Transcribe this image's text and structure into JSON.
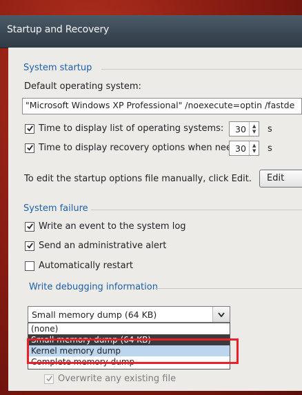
{
  "window": {
    "title": "Startup and Recovery"
  },
  "system_startup": {
    "group_label": "System startup",
    "default_os_label": "Default operating system:",
    "default_os_value": "\"Microsoft Windows XP Professional\" /noexecute=optin /fastde",
    "time_list_label": "Time to display list of operating systems:",
    "time_list_checked": true,
    "time_list_value": "30",
    "time_recovery_label": "Time to display recovery options when needed:",
    "time_recovery_checked": true,
    "time_recovery_value": "30",
    "unit_label": "s",
    "edit_instructions": "To edit the startup options file manually, click Edit.",
    "edit_button": "Edit"
  },
  "system_failure": {
    "group_label": "System failure",
    "write_event_label": "Write an event to the system log",
    "write_event_checked": true,
    "send_alert_label": "Send an administrative alert",
    "send_alert_checked": true,
    "auto_restart_label": "Automatically restart",
    "auto_restart_checked": false
  },
  "debugging": {
    "group_label": "Write debugging information",
    "selected_value": "Small memory dump (64 KB)",
    "options": [
      "(none)",
      "Small memory dump (64 KB)",
      "Kernel memory dump",
      "Complete memory dump"
    ],
    "highlighted_option_index": 2,
    "overwrite_label": "Overwrite any existing file",
    "overwrite_checked": true
  },
  "annotation": {
    "highlight_color": "#e8212b"
  }
}
